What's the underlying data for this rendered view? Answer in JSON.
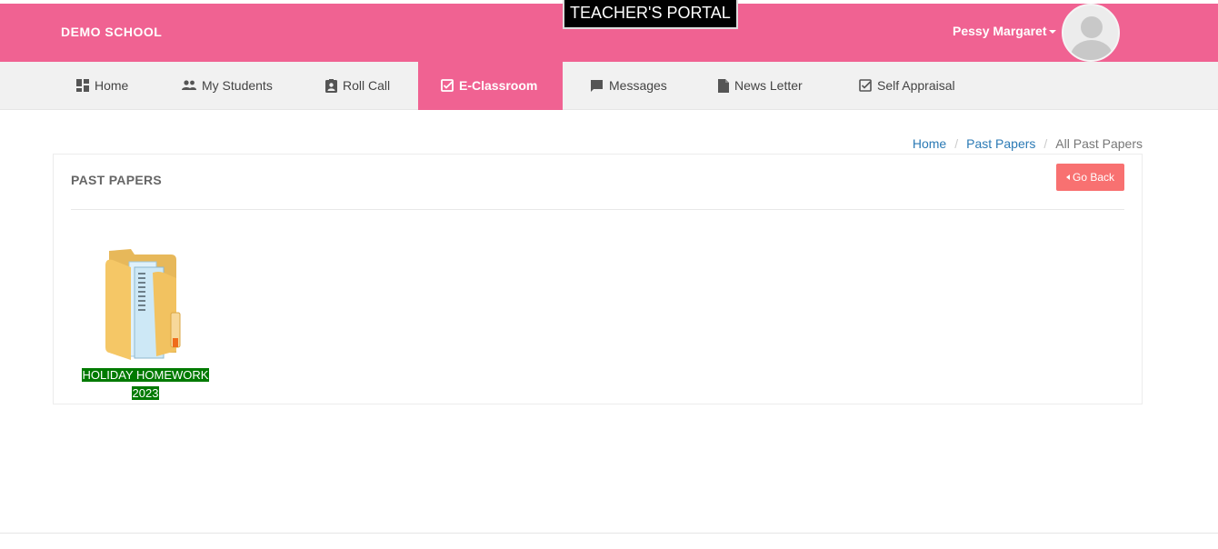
{
  "header": {
    "school_name": "DEMO SCHOOL",
    "portal_label": "TEACHER'S PORTAL",
    "user_name": "Pessy Margaret",
    "brand_color": "#f06292"
  },
  "nav": {
    "items": [
      {
        "label": "Home",
        "icon": "dashboard-icon"
      },
      {
        "label": "My Students",
        "icon": "people-icon"
      },
      {
        "label": "Roll Call",
        "icon": "contact-card-icon"
      },
      {
        "label": "E-Classroom",
        "icon": "check-box-icon",
        "active": true
      },
      {
        "label": "Messages",
        "icon": "chat-bubble-icon"
      },
      {
        "label": "News Letter",
        "icon": "document-icon"
      },
      {
        "label": "Self Appraisal",
        "icon": "check-box-outline-icon"
      }
    ]
  },
  "breadcrumb": {
    "items": [
      "Home",
      "Past Papers",
      "All Past Papers"
    ],
    "separator": "/"
  },
  "panel": {
    "title": "PAST PAPERS",
    "go_back_label": "Go Back",
    "go_back_color": "#f87171"
  },
  "folders": [
    {
      "line1": "HOLIDAY HOMEWORK",
      "line2": "2023",
      "label_color": "#007a00",
      "icon": "folder-icon"
    }
  ]
}
